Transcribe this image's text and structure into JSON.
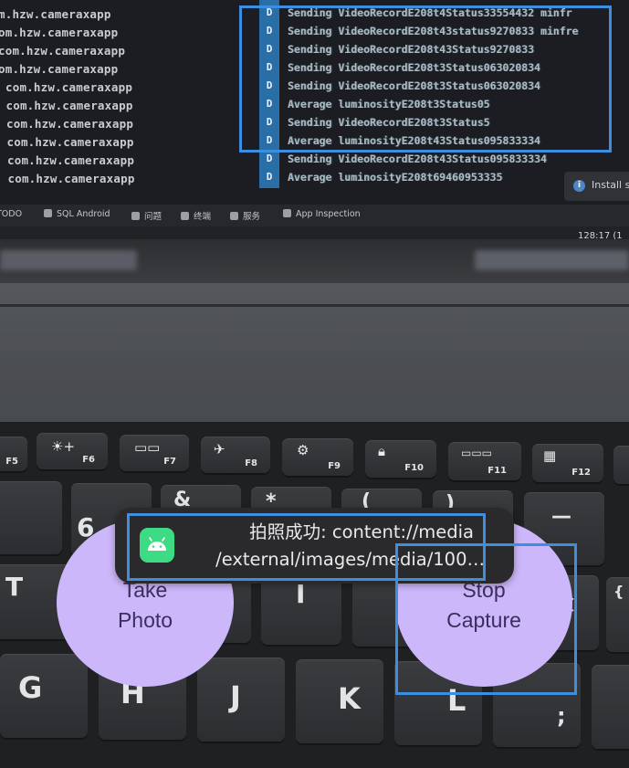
{
  "log_panel": {
    "package_rows": [
      "m.hzw.cameraxapp",
      "om.hzw.cameraxapp",
      "com.hzw.cameraxapp",
      "om.hzw.cameraxapp",
      "com.hzw.cameraxapp",
      "com.hzw.cameraxapp",
      "com.hzw.cameraxapp",
      "com.hzw.cameraxapp",
      "com.hzw.cameraxapp",
      "com.hzw.cameraxapp"
    ],
    "level_tags": [
      "D",
      "D",
      "D",
      "D",
      "D",
      "D",
      "D",
      "D",
      "D",
      "D"
    ],
    "messages": [
      "Sending VideoRecordE208t4Status33554432 minfr",
      "Sending VideoRecordE208t43status9270833 minfre",
      "Sending VideoRecordE208t43Status9270833",
      "Sending VideoRecordE208t3Status063020834",
      "Sending VideoRecordE208t3Status063020834",
      "Average luminosityE208t3Status05",
      "Sending VideoRecordE208t3Status5",
      "Average luminosityE208t43Status095833334",
      "Sending VideoRecordE208t43Status095833334",
      "Average luminosityE208t69460953335"
    ],
    "install_chip": "Install s"
  },
  "ide_toolbar": {
    "items": [
      "TODO",
      "SQL Android",
      "问题",
      "终端",
      "服务",
      "App Inspection"
    ],
    "caret_position": "128:17 (1"
  },
  "keyboard": {
    "function_keys": [
      "F5",
      "F6",
      "F7",
      "F8",
      "F9",
      "F10",
      "F11",
      "F12"
    ],
    "number_row": [
      "6",
      "&",
      "*",
      "(",
      ")",
      "—"
    ],
    "letter_row_1": [
      "T",
      "I",
      "[",
      "{"
    ],
    "letter_row_2": [
      "G",
      "H",
      "J",
      "K",
      "L",
      ";"
    ]
  },
  "app": {
    "take_photo_label_line1": "Take",
    "take_photo_label_line2": "Photo",
    "stop_capture_label_line1": "Stop",
    "stop_capture_label_line2": "Capture",
    "toast": {
      "line1": "拍照成功: content://media",
      "line2": "/external/images/media/100…"
    },
    "accent_color": "#cdb7fb",
    "highlight_color": "#3d8ede"
  }
}
